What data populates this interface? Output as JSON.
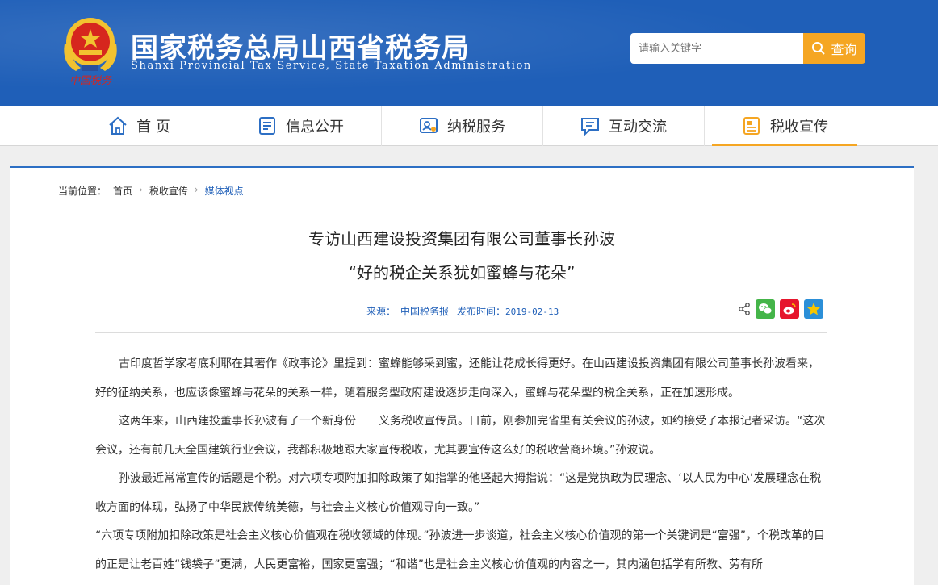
{
  "header": {
    "site_title": "国家税务总局山西省税务局",
    "site_subtitle": "Shanxi Provincial Tax Service, State Taxation Administration",
    "emblem_caption": "中国税务",
    "search_placeholder": "请输入关键字",
    "search_button": "查询"
  },
  "nav": {
    "items": [
      {
        "label": "首 页",
        "icon": "home-icon"
      },
      {
        "label": "信息公开",
        "icon": "document-list-icon"
      },
      {
        "label": "纳税服务",
        "icon": "service-icon"
      },
      {
        "label": "互动交流",
        "icon": "chat-icon"
      },
      {
        "label": "税收宣传",
        "icon": "publicity-icon"
      }
    ],
    "active_index": 4
  },
  "breadcrumb": {
    "label": "当前位置：",
    "items": [
      "首页",
      "税收宣传",
      "媒体视点"
    ]
  },
  "article": {
    "title_line1": "专访山西建设投资集团有限公司董事长孙波",
    "title_line2": "“好的税企关系犹如蜜蜂与花朵”",
    "source_label": "来源：",
    "source": "中国税务报",
    "date_label": "发布时间：",
    "date": "2019-02-13",
    "paragraphs": [
      "古印度哲学家考底利耶在其著作《政事论》里提到：蜜蜂能够采到蜜，还能让花成长得更好。在山西建设投资集团有限公司董事长孙波看来，好的征纳关系，也应该像蜜蜂与花朵的关系一样，随着服务型政府建设逐步走向深入，蜜蜂与花朵型的税企关系，正在加速形成。",
      "这两年来，山西建投董事长孙波有了一个新身份－－义务税收宣传员。日前，刚参加完省里有关会议的孙波，如约接受了本报记者采访。“这次会议，还有前几天全国建筑行业会议，我都积极地跟大家宣传税收，尤其要宣传这么好的税收营商环境。”孙波说。",
      "孙波最近常常宣传的话题是个税。对六项专项附加扣除政策了如指掌的他竖起大拇指说：“这是党执政为民理念、‘以人民为中心’发展理念在税收方面的体现，弘扬了中华民族传统美德，与社会主义核心价值观导向一致。”",
      "“六项专项附加扣除政策是社会主义核心价值观在税收领域的体现。”孙波进一步谈道，社会主义核心价值观的第一个关键词是“富强”，个税改革的目的正是让老百姓“钱袋子”更满，人民更富裕，国家更富强；“和谐”也是社会主义核心价值观的内容之一，其内涵包括学有所教、劳有所"
    ]
  },
  "share": {
    "icons": [
      "share-icon",
      "wechat-icon",
      "weibo-icon",
      "favorite-star-icon"
    ],
    "colors": {
      "wechat": "#44b549",
      "weibo": "#e6162d",
      "star_bg": "#2b8fd8",
      "star": "#f7c600"
    }
  },
  "colors": {
    "header_bg": "#1f5fb8",
    "accent": "#f5a623",
    "link": "#1f5fb8"
  }
}
